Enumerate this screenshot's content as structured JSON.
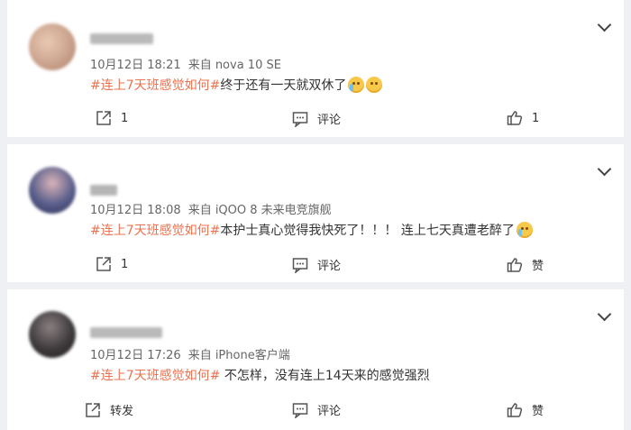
{
  "posts": [
    {
      "timestamp": "10月12日 18:21",
      "source": "来自 nova 10 SE",
      "topic": "#连上7天班感觉如何#",
      "text": "终于还有一天就双休了",
      "emojis": [
        "crying-face",
        "grin-face"
      ],
      "repost": "1",
      "comment": "评论",
      "like": "1",
      "avatar_color": "#c8a08a"
    },
    {
      "timestamp": "10月12日 18:08",
      "source": "来自 iQOO 8 未来电竞旗舰",
      "topic": "#连上7天班感觉如何#",
      "text": "本护士真心觉得我快死了！！！ 连上七天真遭老醉了",
      "emojis": [
        "crying-face"
      ],
      "repost": "1",
      "comment": "评论",
      "like": "赞",
      "avatar_color": "#5a5f8c"
    },
    {
      "timestamp": "10月12日 17:26",
      "source": "来自 iPhone客户端",
      "topic": "#连上7天班感觉如何#",
      "text": " 不怎样，没有连上14天来的感觉强烈",
      "emojis": [],
      "repost": "转发",
      "comment": "评论",
      "like": "赞",
      "avatar_color": "#3e3a3c"
    }
  ],
  "colors": {
    "topic": "#eb7350",
    "background": "#eef0f3"
  }
}
